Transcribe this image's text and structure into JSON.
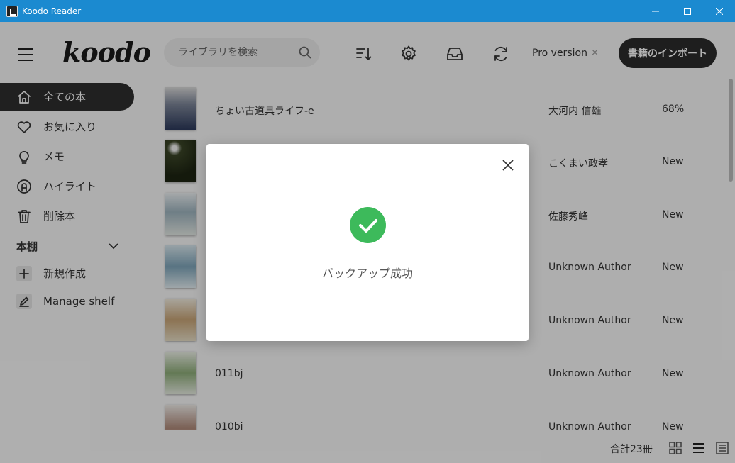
{
  "window": {
    "title": "Koodo Reader",
    "icon": "koodo-app-icon"
  },
  "header": {
    "logo": "koodo",
    "search_placeholder": "ライブラリを検索",
    "pro_link": "Pro version",
    "pro_close": "×",
    "import_button": "書籍のインポート"
  },
  "sidebar": {
    "items": [
      {
        "label": "全ての本",
        "icon": "home-icon",
        "active": true
      },
      {
        "label": "お気に入り",
        "icon": "heart-icon"
      },
      {
        "label": "メモ",
        "icon": "lightbulb-icon"
      },
      {
        "label": "ハイライト",
        "icon": "highlight-icon"
      },
      {
        "label": "削除本",
        "icon": "trash-icon"
      }
    ],
    "shelf_heading": "本棚",
    "shelf_items": [
      {
        "label": "新規作成",
        "icon": "plus-icon"
      },
      {
        "label": "Manage shelf",
        "icon": "edit-icon"
      }
    ]
  },
  "books": [
    {
      "title": "ちょい古道具ライフ-e",
      "author": "大河内 信雄",
      "progress": "68%",
      "cover_color": "#2d3a5c"
    },
    {
      "title": "",
      "author": "こくまい政孝",
      "progress": "New",
      "cover_color": "#1d2412"
    },
    {
      "title": "",
      "author": "佐藤秀峰",
      "progress": "New",
      "cover_color": "#c8d4d8"
    },
    {
      "title": "",
      "author": "Unknown Author",
      "progress": "New",
      "cover_color": "#a9c7d6"
    },
    {
      "title": "",
      "author": "Unknown Author",
      "progress": "New",
      "cover_color": "#d6c9a8"
    },
    {
      "title": "011bj",
      "author": "Unknown Author",
      "progress": "New",
      "cover_color": "#c9d8b8"
    },
    {
      "title": "010bj",
      "author": "Unknown Author",
      "progress": "New",
      "cover_color": "#d9c7c0"
    }
  ],
  "footer": {
    "count": "合計23冊"
  },
  "dialog": {
    "message": "バックアップ成功"
  },
  "colors": {
    "accent": "#1b8ad0",
    "success": "#3dba5b",
    "dark": "#2e2e2e"
  }
}
